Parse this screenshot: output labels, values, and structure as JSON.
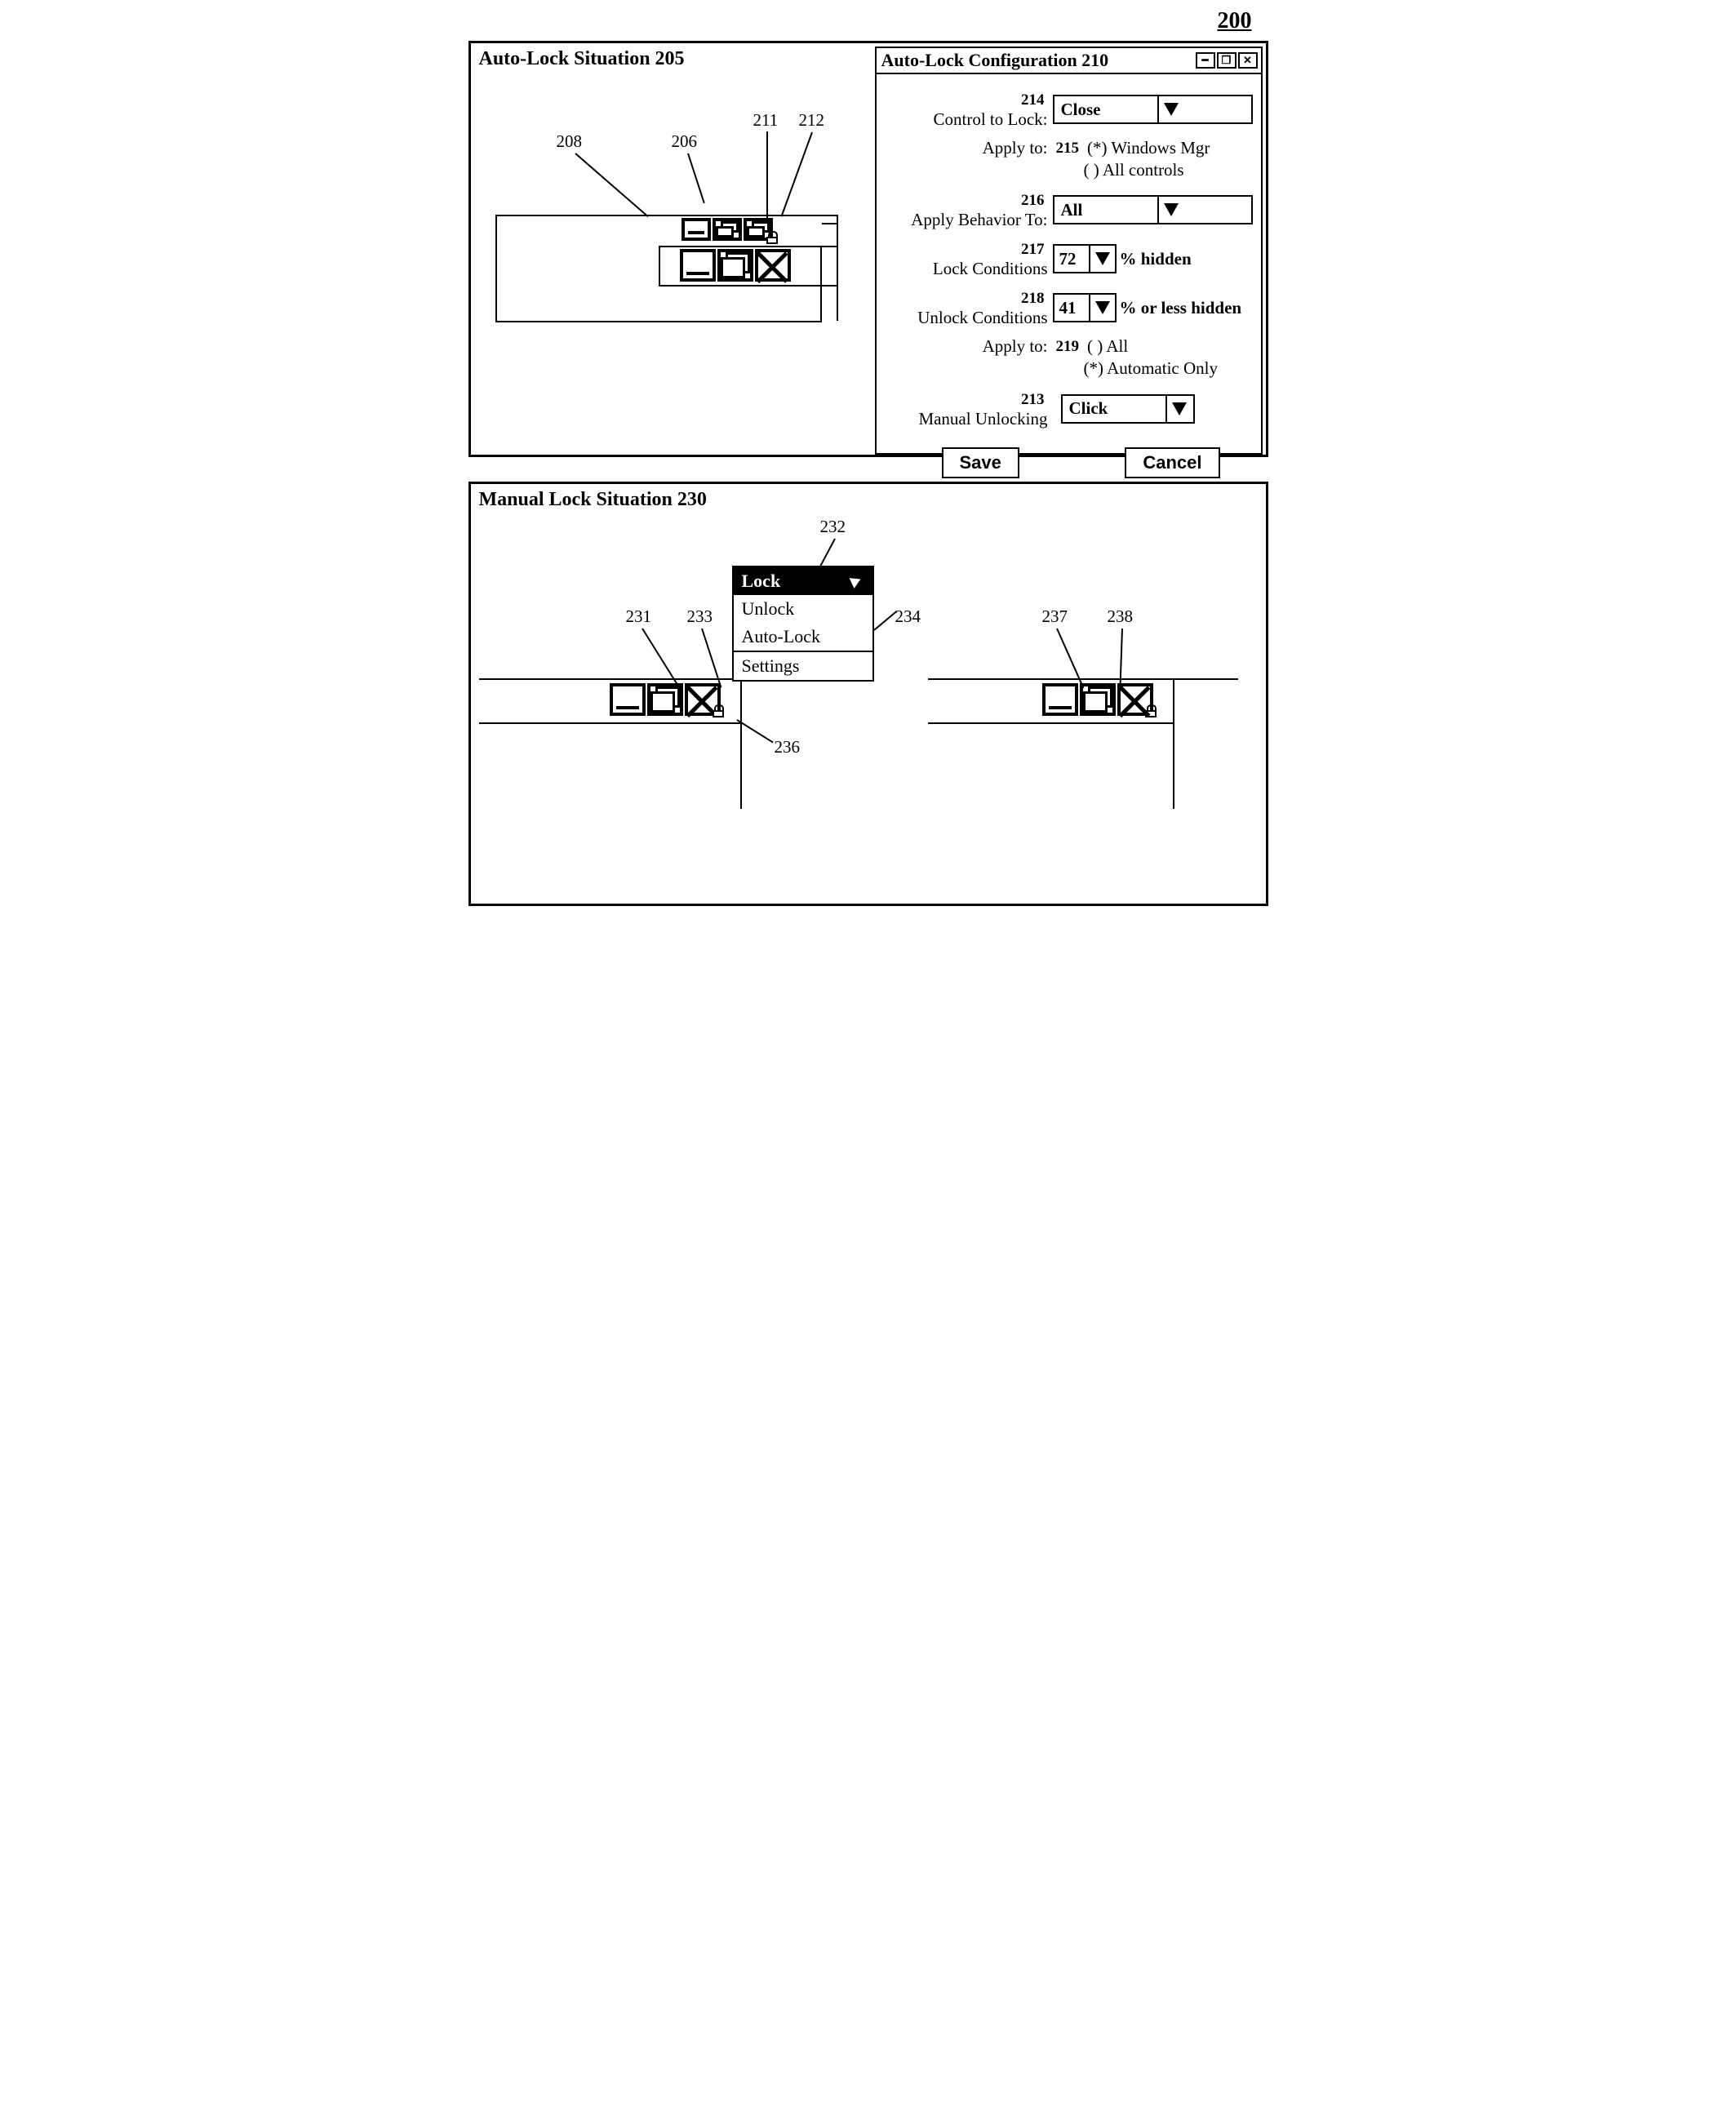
{
  "figure_number": "200",
  "upper": {
    "title": "Auto-Lock Situation 205",
    "callouts": {
      "c208": "208",
      "c206": "206",
      "c211": "211",
      "c212": "212"
    },
    "config": {
      "title": "Auto-Lock Configuration 210",
      "rows": {
        "control_to_lock": {
          "label": "Control to Lock:",
          "ref": "214",
          "value": "Close"
        },
        "apply_to": {
          "label": "Apply to:",
          "ref": "215",
          "opt1": "(*) Windows Mgr",
          "opt2": "( ) All controls"
        },
        "apply_behavior": {
          "label": "Apply Behavior To:",
          "ref": "216",
          "value": "All"
        },
        "lock_cond": {
          "label": "Lock Conditions",
          "ref": "217",
          "value": "72",
          "suffix": "% hidden"
        },
        "unlock_cond": {
          "label": "Unlock Conditions",
          "ref": "218",
          "value": "41",
          "suffix": "% or less hidden"
        },
        "apply_to2": {
          "label": "Apply to:",
          "ref": "219",
          "opt1": "( ) All",
          "opt2": "(*) Automatic Only"
        },
        "manual_unlock": {
          "label": "Manual Unlocking",
          "ref": "213",
          "value": "Click"
        }
      },
      "buttons": {
        "save": "Save",
        "cancel": "Cancel"
      }
    }
  },
  "lower": {
    "title": "Manual Lock Situation 230",
    "callouts": {
      "c231": "231",
      "c232": "232",
      "c233": "233",
      "c234": "234",
      "c236": "236",
      "c237": "237",
      "c238": "238"
    },
    "menu": {
      "lock": "Lock",
      "unlock": "Unlock",
      "autolock": "Auto-Lock",
      "settings": "Settings"
    }
  }
}
